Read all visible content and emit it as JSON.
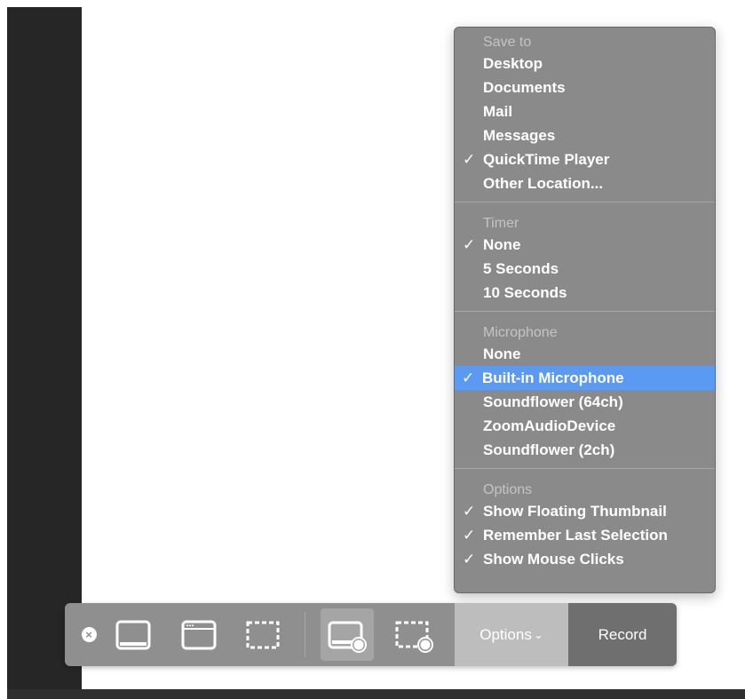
{
  "menu": {
    "sections": [
      {
        "header": "Save to",
        "items": [
          {
            "label": "Desktop",
            "check": ""
          },
          {
            "label": "Documents",
            "check": ""
          },
          {
            "label": "Mail",
            "check": ""
          },
          {
            "label": "Messages",
            "check": ""
          },
          {
            "label": "QuickTime Player",
            "check": "✓"
          },
          {
            "label": "Other Location...",
            "check": ""
          }
        ]
      },
      {
        "header": "Timer",
        "items": [
          {
            "label": "None",
            "check": "✓"
          },
          {
            "label": "5 Seconds",
            "check": ""
          },
          {
            "label": "10 Seconds",
            "check": ""
          }
        ]
      },
      {
        "header": "Microphone",
        "items": [
          {
            "label": "None",
            "check": ""
          },
          {
            "label": "Built-in Microphone",
            "check": "✓",
            "highlighted": true
          },
          {
            "label": "Soundflower (64ch)",
            "check": ""
          },
          {
            "label": "ZoomAudioDevice",
            "check": ""
          },
          {
            "label": "Soundflower (2ch)",
            "check": ""
          }
        ]
      },
      {
        "header": "Options",
        "items": [
          {
            "label": "Show Floating Thumbnail",
            "check": "✓"
          },
          {
            "label": "Remember Last Selection",
            "check": "✓"
          },
          {
            "label": "Show Mouse Clicks",
            "check": "✓"
          }
        ]
      }
    ],
    "highlight_color": "#5a9af2"
  },
  "toolbar": {
    "close_icon": "×",
    "options_label": "Options",
    "options_chevron": "⌄",
    "record_label": "Record",
    "icons": [
      "capture-entire-screen-icon",
      "capture-window-icon",
      "capture-selected-portion-icon",
      "record-entire-screen-icon",
      "record-selected-portion-icon"
    ],
    "selected_tool": "record-entire-screen"
  }
}
